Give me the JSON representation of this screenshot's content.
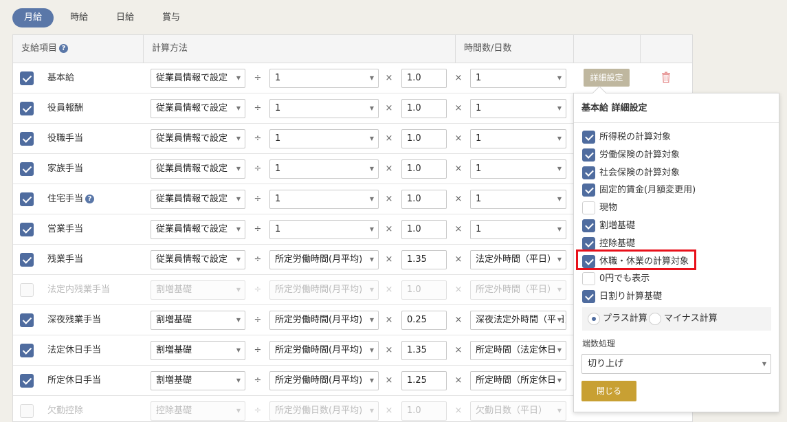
{
  "tabs": [
    "月給",
    "時給",
    "日給",
    "賞与"
  ],
  "header": {
    "item": "支給項目",
    "method": "計算方法",
    "hours": "時間数/日数"
  },
  "operators": {
    "divide": "÷",
    "times": "×"
  },
  "detail_label": "詳細設定",
  "rows": [
    {
      "checked": true,
      "disabled": false,
      "name": "基本給",
      "help": false,
      "method": "従業員情報で設定",
      "divisor": "1",
      "factor": "1.0",
      "hours": "1"
    },
    {
      "checked": true,
      "disabled": false,
      "name": "役員報酬",
      "help": false,
      "method": "従業員情報で設定",
      "divisor": "1",
      "factor": "1.0",
      "hours": "1"
    },
    {
      "checked": true,
      "disabled": false,
      "name": "役職手当",
      "help": false,
      "method": "従業員情報で設定",
      "divisor": "1",
      "factor": "1.0",
      "hours": "1"
    },
    {
      "checked": true,
      "disabled": false,
      "name": "家族手当",
      "help": false,
      "method": "従業員情報で設定",
      "divisor": "1",
      "factor": "1.0",
      "hours": "1"
    },
    {
      "checked": true,
      "disabled": false,
      "name": "住宅手当",
      "help": true,
      "method": "従業員情報で設定",
      "divisor": "1",
      "factor": "1.0",
      "hours": "1"
    },
    {
      "checked": true,
      "disabled": false,
      "name": "営業手当",
      "help": false,
      "method": "従業員情報で設定",
      "divisor": "1",
      "factor": "1.0",
      "hours": "1"
    },
    {
      "checked": true,
      "disabled": false,
      "name": "残業手当",
      "help": false,
      "method": "従業員情報で設定",
      "divisor": "所定労働時間(月平均)",
      "factor": "1.35",
      "hours": "法定外時間（平日）"
    },
    {
      "checked": false,
      "disabled": true,
      "name": "法定内残業手当",
      "help": false,
      "method": "割増基礎",
      "divisor": "所定労働時間(月平均)",
      "factor": "1.0",
      "hours": "所定外時間（平日）"
    },
    {
      "checked": true,
      "disabled": false,
      "name": "深夜残業手当",
      "help": false,
      "method": "割増基礎",
      "divisor": "所定労働時間(月平均)",
      "factor": "0.25",
      "hours": "深夜法定外時間（平日）"
    },
    {
      "checked": true,
      "disabled": false,
      "name": "法定休日手当",
      "help": false,
      "method": "割増基礎",
      "divisor": "所定労働時間(月平均)",
      "factor": "1.35",
      "hours": "所定時間（法定休日）"
    },
    {
      "checked": true,
      "disabled": false,
      "name": "所定休日手当",
      "help": false,
      "method": "割増基礎",
      "divisor": "所定労働時間(月平均)",
      "factor": "1.25",
      "hours": "所定時間（所定休日）"
    },
    {
      "checked": false,
      "disabled": true,
      "name": "欠勤控除",
      "help": false,
      "method": "控除基礎",
      "divisor": "所定労働日数(月平均)",
      "factor": "1.0",
      "hours": "欠勤日数（平日）"
    }
  ],
  "popup": {
    "title": "基本給 詳細設定",
    "options": [
      {
        "label": "所得税の計算対象",
        "checked": true
      },
      {
        "label": "労働保険の計算対象",
        "checked": true
      },
      {
        "label": "社会保険の計算対象",
        "checked": true
      },
      {
        "label": "固定的賃金(月額変更用)",
        "checked": true
      },
      {
        "label": "現物",
        "checked": false
      },
      {
        "label": "割増基礎",
        "checked": true
      },
      {
        "label": "控除基礎",
        "checked": true
      },
      {
        "label": "休職・休業の計算対象",
        "checked": true
      },
      {
        "label": "0円でも表示",
        "checked": false
      },
      {
        "label": "日割り計算基礎",
        "checked": true
      }
    ],
    "radio_plus": "プラス計算",
    "radio_minus": "マイナス計算",
    "rounding_label": "端数処理",
    "rounding_value": "切り上げ",
    "close_label": "閉じる"
  },
  "colors": {
    "accent": "#5a77a8",
    "checkbox": "#4f6c9f",
    "detail_button": "#bfb79f",
    "close_button": "#c8a033",
    "highlight": "#e8101a"
  }
}
